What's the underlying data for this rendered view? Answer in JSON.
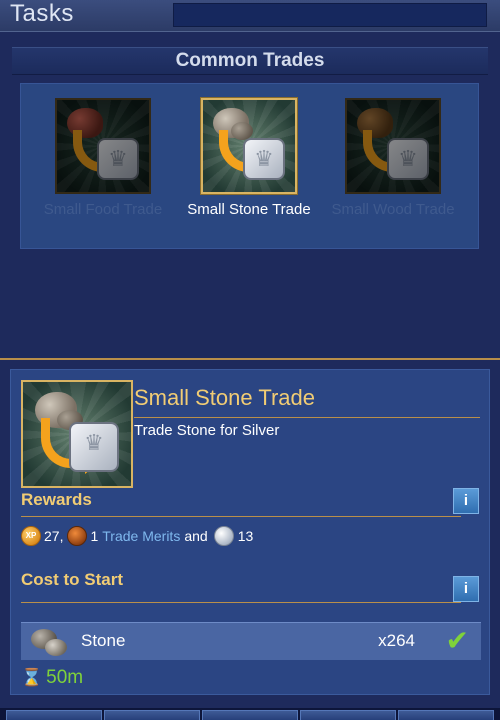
{
  "header": {
    "title": "Tasks"
  },
  "common_trades": {
    "title": "Common Trades",
    "items": [
      {
        "label": "Small Food Trade",
        "resource_icon": "food-icon",
        "state": "disabled"
      },
      {
        "label": "Small Stone Trade",
        "resource_icon": "stone-icon",
        "state": "selected"
      },
      {
        "label": "Small Wood Trade",
        "resource_icon": "wood-icon",
        "state": "disabled"
      }
    ]
  },
  "detail": {
    "title": "Small Stone Trade",
    "description": "Trade Stone for Silver",
    "rewards": {
      "heading": "Rewards",
      "info_label": "i",
      "xp_icon_label": "XP",
      "xp_value": "27,",
      "merits_value": "1",
      "merits_label": "Trade Merits",
      "and_text": "and",
      "silver_value": "13"
    },
    "cost": {
      "heading": "Cost to Start",
      "info_label": "i",
      "resource_name": "Stone",
      "quantity": "x264",
      "status_icon": "check-icon"
    },
    "duration": "50m"
  },
  "colors": {
    "accent_gold": "#f1cc74",
    "link_blue": "#7fb8ee",
    "success_green": "#7fd23a",
    "panel_blue": "#2b4583",
    "background": "#1a2350"
  }
}
